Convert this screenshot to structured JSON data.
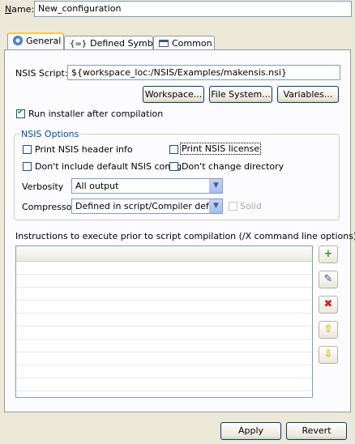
{
  "name_row": {
    "label": "Name:",
    "value": "New_configuration"
  },
  "tabs": [
    {
      "label": "General",
      "icon": "gear-icon"
    },
    {
      "label": "Defined Symbols",
      "icon": "braces-icon"
    },
    {
      "label": "Common",
      "icon": "window-icon"
    }
  ],
  "script": {
    "label": "NSIS Script:",
    "value": "${workspace_loc:/NSIS/Examples/makensis.nsi}",
    "buttons": {
      "workspace": "Workspace...",
      "filesystem": "File System...",
      "variables": "Variables..."
    }
  },
  "run_installer": {
    "label": "Run installer after compilation",
    "checked": true
  },
  "options": {
    "title": "NSIS Options",
    "print_header": "Print NSIS header info",
    "print_license": "Print NSIS license",
    "no_default_config": "Don't include default NSIS config",
    "no_change_dir": "Don't change directory",
    "verbosity_label": "Verbosity",
    "verbosity_value": "All output",
    "compressor_label": "Compressor",
    "compressor_value": "Defined in script/Compiler default",
    "solid_label": "Solid"
  },
  "instructions": {
    "label": "Instructions to execute prior to script compilation (/X command line options)"
  },
  "footer": {
    "apply": "Apply",
    "revert": "Revert"
  },
  "colors": {
    "accent_blue": "#0046d5",
    "panel": "#ece9d8",
    "tab_highlight": "#ffc83c"
  }
}
